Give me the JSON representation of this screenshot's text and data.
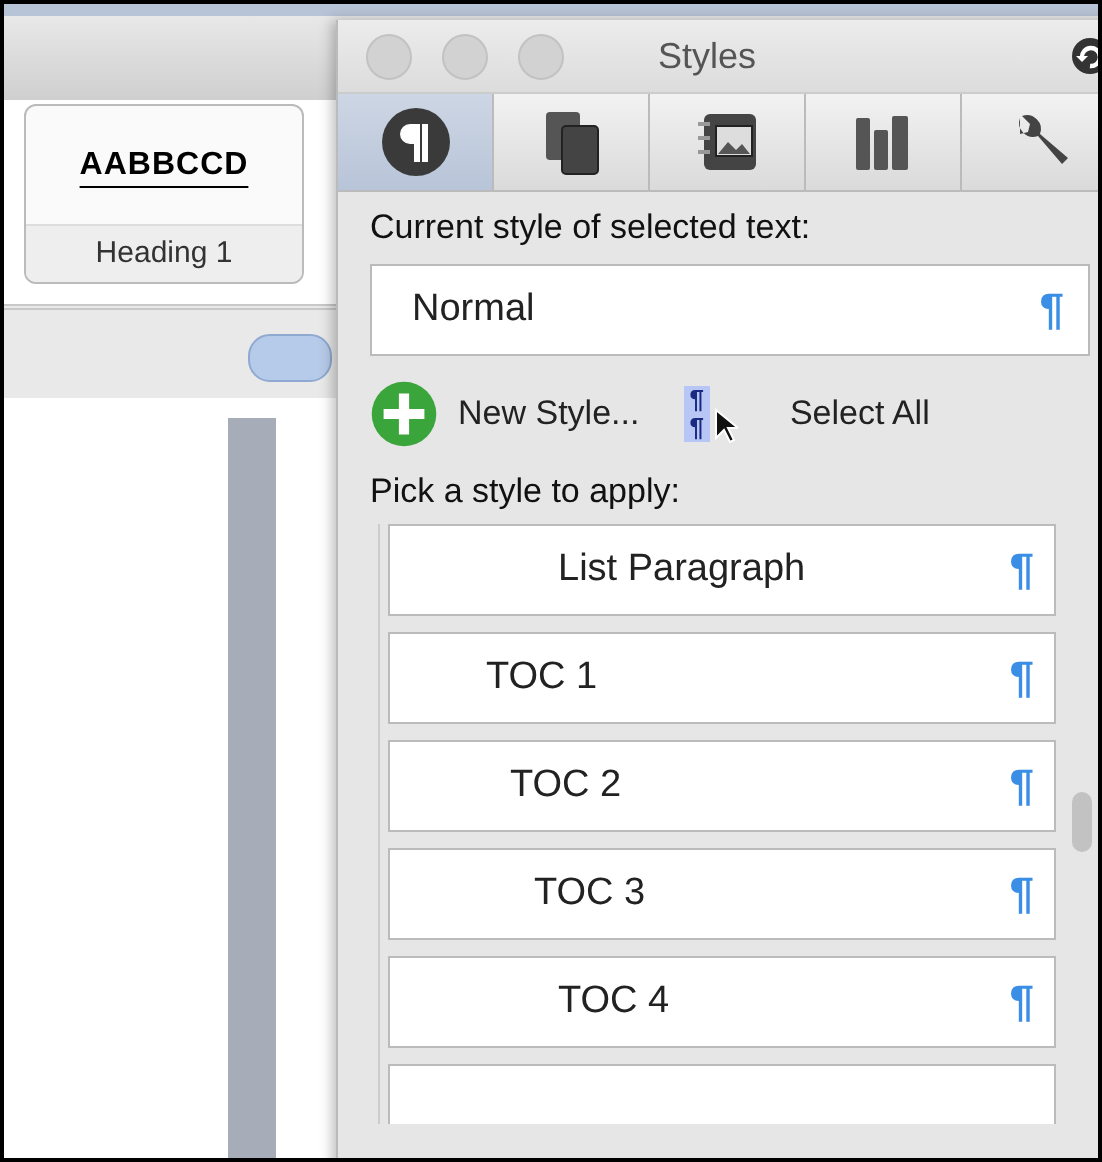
{
  "background_window": {
    "style_gallery": {
      "preview": "AABBCCD",
      "label": "Heading 1"
    }
  },
  "styles_panel": {
    "title": "Styles",
    "tabs": [
      {
        "kind": "paragraph",
        "selected": true
      },
      {
        "kind": "pages",
        "selected": false
      },
      {
        "kind": "media",
        "selected": false
      },
      {
        "kind": "books",
        "selected": false
      },
      {
        "kind": "tools",
        "selected": false
      }
    ],
    "current_style_label": "Current style of selected text:",
    "current_style": {
      "value": "Normal",
      "mark": "¶"
    },
    "new_style_button": "New Style...",
    "select_all_marks": "¶\n¶",
    "select_all_button": "Select All",
    "pick_label": "Pick a style to apply:",
    "styles": [
      {
        "name": "List Paragraph",
        "mark": "¶"
      },
      {
        "name": "TOC 1",
        "mark": "¶"
      },
      {
        "name": "TOC 2",
        "mark": "¶"
      },
      {
        "name": "TOC 3",
        "mark": "¶"
      },
      {
        "name": "TOC 4",
        "mark": "¶"
      }
    ]
  }
}
